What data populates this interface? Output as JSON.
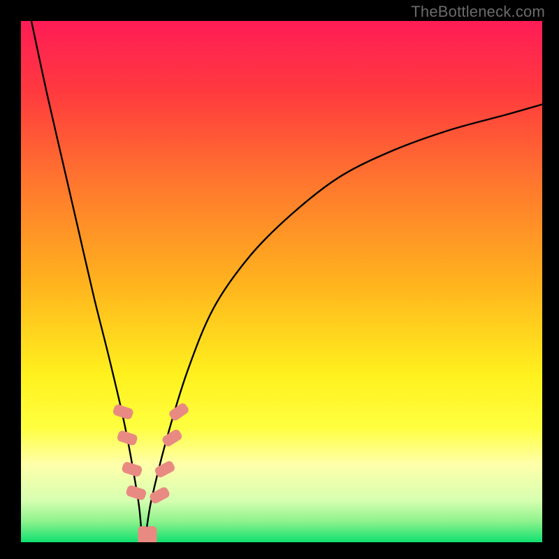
{
  "attribution": "TheBottleneck.com",
  "chart_data": {
    "type": "line",
    "title": "",
    "xlabel": "",
    "ylabel": "",
    "xlim": [
      0,
      1
    ],
    "ylim": [
      0,
      100
    ],
    "gradient_stops": [
      {
        "offset": 0,
        "color": "#ff1c56"
      },
      {
        "offset": 0.14,
        "color": "#ff3b3e"
      },
      {
        "offset": 0.32,
        "color": "#ff7a2d"
      },
      {
        "offset": 0.5,
        "color": "#ffb21e"
      },
      {
        "offset": 0.68,
        "color": "#fff11e"
      },
      {
        "offset": 0.78,
        "color": "#ffff40"
      },
      {
        "offset": 0.85,
        "color": "#ffffaa"
      },
      {
        "offset": 0.92,
        "color": "#d6ffb0"
      },
      {
        "offset": 0.96,
        "color": "#8ef28c"
      },
      {
        "offset": 1.0,
        "color": "#10e070"
      }
    ],
    "bottleneck_min_x": 0.235,
    "series": [
      {
        "name": "bottleneck",
        "x": [
          0.02,
          0.05,
          0.08,
          0.11,
          0.14,
          0.17,
          0.2,
          0.225,
          0.235,
          0.25,
          0.28,
          0.32,
          0.37,
          0.44,
          0.52,
          0.61,
          0.71,
          0.82,
          0.93,
          1.0
        ],
        "y": [
          100,
          86,
          73,
          60,
          47,
          35,
          22,
          8,
          0,
          8,
          20,
          33,
          45,
          55,
          63,
          70,
          75,
          79,
          82,
          84
        ]
      }
    ],
    "markers": [
      {
        "x": 0.196,
        "y": 25,
        "angle": -72
      },
      {
        "x": 0.204,
        "y": 20,
        "angle": -72
      },
      {
        "x": 0.213,
        "y": 14,
        "angle": -72
      },
      {
        "x": 0.221,
        "y": 9.5,
        "angle": -72
      },
      {
        "x": 0.235,
        "y": 1.2,
        "angle": 0
      },
      {
        "x": 0.25,
        "y": 1.2,
        "angle": 0
      },
      {
        "x": 0.266,
        "y": 9,
        "angle": 62
      },
      {
        "x": 0.276,
        "y": 14,
        "angle": 62
      },
      {
        "x": 0.29,
        "y": 20,
        "angle": 58
      },
      {
        "x": 0.303,
        "y": 25,
        "angle": 55
      }
    ],
    "marker_style": {
      "fill": "#e98a82",
      "rx": 6,
      "half_w": 8,
      "half_h": 14
    }
  }
}
